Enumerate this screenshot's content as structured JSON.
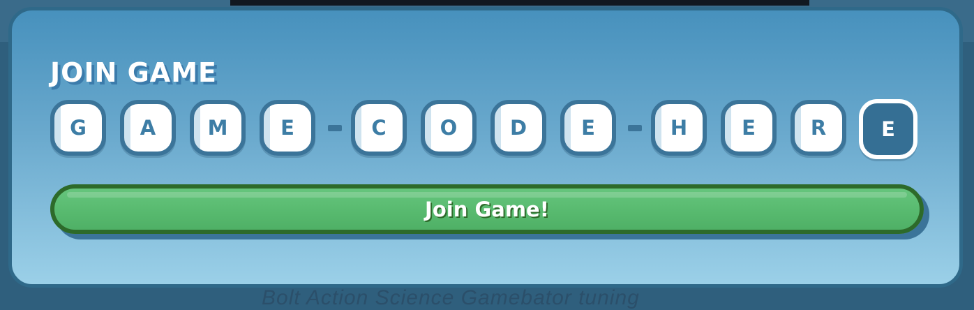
{
  "background": {
    "footer_text": "Bolt Action Science Gamebator tuning"
  },
  "dialog": {
    "title": "JOIN GAME",
    "code_tiles": [
      "G",
      "A",
      "M",
      "E",
      "C",
      "O",
      "D",
      "E",
      "H",
      "E",
      "R",
      "E"
    ],
    "separators": [
      "-",
      "-"
    ],
    "join_button_label": "Join Game!"
  },
  "colors": {
    "panel_top": "#4791bd",
    "panel_bottom": "#9bd0e8",
    "tile_border": "#3b7499",
    "tile_text": "#3d7da5",
    "active_tile_bg": "#356f94",
    "button_green": "#57b96e",
    "button_border": "#2d6a2a"
  }
}
